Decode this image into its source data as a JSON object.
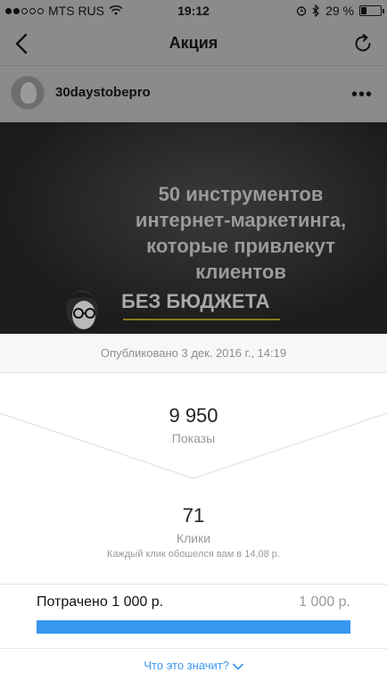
{
  "status_bar": {
    "carrier": "MTS RUS",
    "time": "19:12",
    "battery_percent": "29 %"
  },
  "nav": {
    "title": "Акция",
    "back_icon": "chevron-left-icon",
    "refresh_icon": "refresh-icon"
  },
  "post": {
    "username": "30daystobepro",
    "image_caption_lines": [
      "50 инструментов",
      "интернет-маркетинга,",
      "которые привлекут",
      "клиентов"
    ],
    "image_caption_strong": "БЕЗ БЮДЖЕТА"
  },
  "insights": {
    "published": "Опубликовано 3 дек. 2016 г., 14:19",
    "impressions_value": "9 950",
    "impressions_label": "Показы",
    "clicks_value": "71",
    "clicks_label": "Клики",
    "cost_per_click_note": "Каждый клик обошелся вам в 14,08 р.",
    "spent_label": "Потрачено 1 000 р.",
    "budget_total": "1 000 р.",
    "spent_fraction": 1.0,
    "help_link": "Что это значит?"
  },
  "colors": {
    "accent": "#3897f0"
  }
}
